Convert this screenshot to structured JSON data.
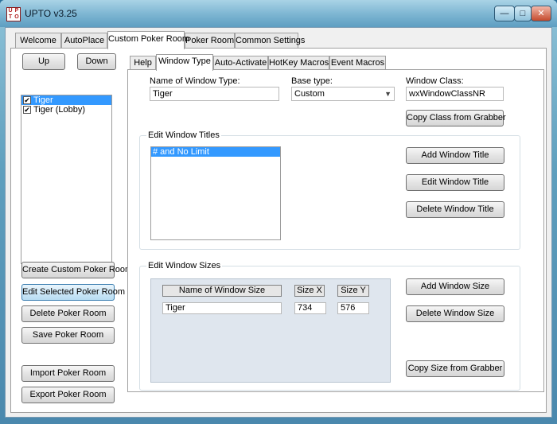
{
  "window": {
    "title": "UPTO  v3.25",
    "icon_letters": [
      "U",
      "P",
      "T",
      "O"
    ],
    "min_glyph": "—",
    "max_glyph": "□",
    "close_glyph": "✕"
  },
  "main_tabs": [
    "Welcome",
    "AutoPlace",
    "Custom Poker Room",
    "Poker Room",
    "Common Settings"
  ],
  "left": {
    "up_label": "Up",
    "down_label": "Down",
    "rooms": [
      {
        "label": "Tiger",
        "checked": true
      },
      {
        "label": "Tiger (Lobby)",
        "checked": true
      }
    ],
    "check_glyph": "✔",
    "buttons": {
      "create": "Create Custom Poker Room",
      "edit": "Edit Selected Poker Room",
      "delete": "Delete Poker Room",
      "save": "Save Poker Room",
      "import": "Import Poker Room",
      "export": "Export Poker Room"
    }
  },
  "sub_tabs": [
    "Help",
    "Window Type",
    "Auto-Activate",
    "HotKey Macros",
    "Event Macros"
  ],
  "window_type": {
    "name_label": "Name of Window Type:",
    "name_value": "Tiger",
    "base_label": "Base type:",
    "base_value": "Custom",
    "base_arrow": "▼",
    "class_label": "Window Class:",
    "class_value": "wxWindowClassNR",
    "copy_class_button": "Copy Class from Grabber"
  },
  "titles_group": {
    "title": "Edit Window Titles",
    "items": [
      "# and No Limit"
    ],
    "add": "Add Window Title",
    "edit": "Edit Window Title",
    "delete": "Delete Window Title"
  },
  "sizes_group": {
    "title": "Edit Window Sizes",
    "col_name": "Name of Window Size",
    "col_x": "Size X",
    "col_y": "Size Y",
    "row": {
      "name": "Tiger",
      "x": "734",
      "y": "576"
    },
    "add": "Add Window Size",
    "delete": "Delete Window Size",
    "copy": "Copy Size from Grabber"
  }
}
